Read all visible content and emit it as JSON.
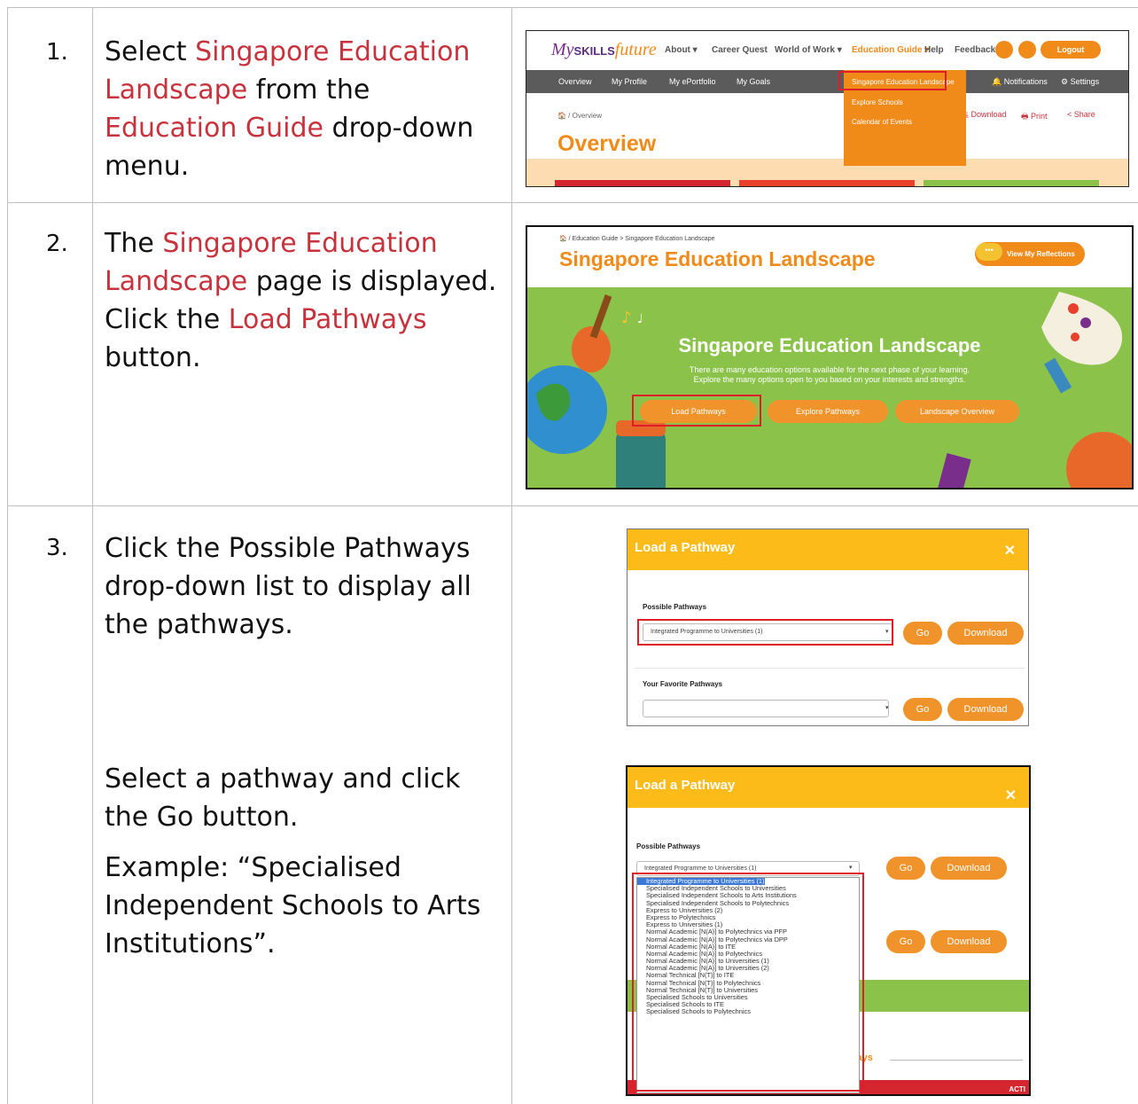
{
  "steps": [
    {
      "num": "1.",
      "parts": [
        {
          "t": "Select "
        },
        {
          "t": "Singapore Education Landscape",
          "red": true
        },
        {
          "t": " from the "
        },
        {
          "t": "Education Guide",
          "red": true
        },
        {
          "t": " drop-down menu."
        }
      ]
    },
    {
      "num": "2.",
      "parts": [
        {
          "t": "The "
        },
        {
          "t": "Singapore Education Landscape",
          "red": true
        },
        {
          "t": " page is displayed. Click the "
        },
        {
          "t": "Load Pathways",
          "red": true
        },
        {
          "t": " button."
        }
      ]
    },
    {
      "num": "3.",
      "parts": [
        {
          "t": "Click the Possible Pathways drop-down list to display all the pathways."
        }
      ],
      "text_b": "Select a pathway and click the Go button.",
      "text_c": "Example: “Specialised Independent Schools to Arts Institutions”."
    }
  ],
  "shot1": {
    "logo_my": "My",
    "logo_skills": "SKILLS",
    "logo_future": "future",
    "nav": [
      "About ▾",
      "Career Quest",
      "World of Work ▾",
      "Education Guide ▾",
      "Help",
      "Feedback"
    ],
    "logout": "Logout",
    "subnav": [
      "Overview",
      "My Profile",
      "My ePortfolio",
      "My Goals"
    ],
    "subnav_right": [
      "🔔 Notifications",
      "⚙ Settings"
    ],
    "menu_items": [
      "Singapore Education Landscape",
      "Explore Schools",
      "Calendar of Events"
    ],
    "breadcrumb": "🏠 / Overview",
    "tools": [
      "⤓ Download",
      "🖶 Print",
      "< Share"
    ],
    "title": "Overview",
    "colors": {
      "orange": "#f08b1a",
      "purple": "#7a2e8c",
      "highlight": "#e01e2a"
    }
  },
  "shot2": {
    "breadcrumb": "🏠 / Education Guide > Singapore Education Landscape",
    "heading": "Singapore Education Landscape",
    "reflections": "View My Reflections",
    "banner_title": "Singapore Education Landscape",
    "banner_line1": "There are many education options available for the next phase of your learning.",
    "banner_line2": "Explore the many options open to you based on your interests and strengths.",
    "buttons": [
      "Load Pathways",
      "Explore Pathways",
      "Landscape Overview"
    ]
  },
  "dialog": {
    "title": "Load a Pathway",
    "possible_label": "Possible Pathways",
    "selected": "Integrated Programme to Universities (1)",
    "favorite_label": "Your Favorite Pathways",
    "go": "Go",
    "download": "Download",
    "pathways_partial": "ways",
    "acti_partial": "ACTI",
    "options": [
      "Integrated Programme to Universities (1)",
      "Integrated Programme to Universities (2)",
      "Specialised Independent Schools to Universities",
      "Specialised Independent Schools to Arts Institutions",
      "Specialised Independent Schools to Polytechnics",
      "Express to Universities (2)",
      "Express to Polytechnics",
      "Express to Universities (1)",
      "Normal Academic [N(A)] to Polytechnics via PFP",
      "Normal Academic [N(A)] to Polytechnics via DPP",
      "Normal Academic [N(A)] to ITE",
      "Normal Academic [N(A)] to Polytechnics",
      "Normal Academic [N(A)] to Universities (1)",
      "Normal Academic [N(A)] to Universities (2)",
      "Normal Technical [N(T)] to ITE",
      "Normal Technical [N(T)] to Polytechnics",
      "Normal Technical [N(T)] to Universities",
      "Specialised Schools to Universities",
      "Specialised Schools to ITE",
      "Specialised Schools to Polytechnics"
    ]
  }
}
